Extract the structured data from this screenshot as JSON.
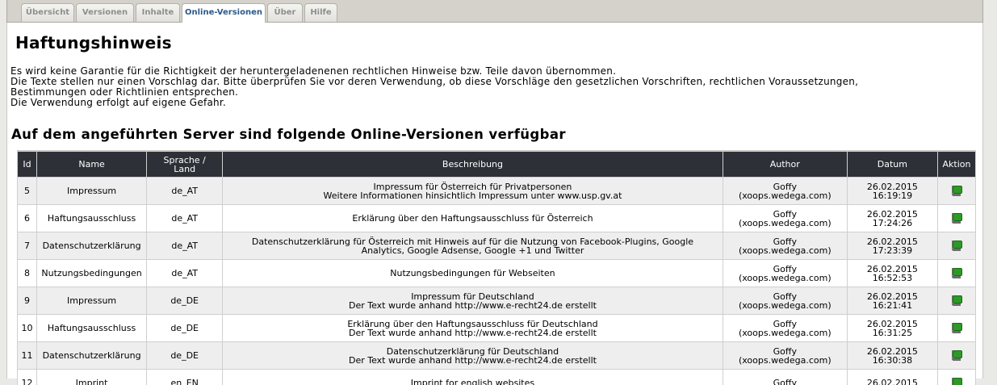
{
  "tabs": [
    {
      "label": "Übersicht",
      "active": false
    },
    {
      "label": "Versionen",
      "active": false
    },
    {
      "label": "Inhalte",
      "active": false
    },
    {
      "label": "Online-Versionen",
      "active": true
    },
    {
      "label": "Über",
      "active": false
    },
    {
      "label": "Hilfe",
      "active": false
    }
  ],
  "page": {
    "title": "Haftungshinweis",
    "disclaimer_lines": [
      "Es wird keine Garantie für die Richtigkeit der heruntergeladenenen rechtlichen Hinweise bzw. Teile davon übernommen.",
      "Die Texte stellen nur einen Vorschlag dar. Bitte überprüfen Sie vor deren Verwendung, ob diese Vorschläge den gesetzlichen Vorschriften, rechtlichen Voraussetzungen,",
      "Bestimmungen oder Richtlinien entsprechen.",
      "Die Verwendung erfolgt auf eigene Gefahr."
    ],
    "section_title": "Auf dem angeführten Server sind folgende Online-Versionen verfügbar"
  },
  "table": {
    "headers": {
      "id": "Id",
      "name": "Name",
      "lang_1": "Sprache /",
      "lang_2": "Land",
      "description": "Beschreibung",
      "author": "Author",
      "date": "Datum",
      "action": "Aktion"
    },
    "action_icon": "download-icon",
    "rows": [
      {
        "id": "5",
        "name": "Impressum",
        "lang": "de_AT",
        "desc_1": "Impressum für Österreich für Privatpersonen",
        "desc_2": "Weitere Informationen hinsichtlich Impressum unter www.usp.gv.at",
        "author_1": "Goffy",
        "author_2": "(xoops.wedega.com)",
        "date": "26.02.2015",
        "time": "16:19:19"
      },
      {
        "id": "6",
        "name": "Haftungsausschluss",
        "lang": "de_AT",
        "desc_1": "Erklärung über den Haftungsausschluss für Österreich",
        "desc_2": "",
        "author_1": "Goffy",
        "author_2": "(xoops.wedega.com)",
        "date": "26.02.2015",
        "time": "17:24:26"
      },
      {
        "id": "7",
        "name": "Datenschutzerklärung",
        "lang": "de_AT",
        "desc_1": "Datenschutzerklärung für Österreich mit Hinweis auf für die Nutzung von Facebook-Plugins, Google",
        "desc_2": "Analytics, Google Adsense, Google +1 und Twitter",
        "author_1": "Goffy",
        "author_2": "(xoops.wedega.com)",
        "date": "26.02.2015",
        "time": "17:23:39"
      },
      {
        "id": "8",
        "name": "Nutzungsbedingungen",
        "lang": "de_AT",
        "desc_1": "Nutzungsbedingungen für Webseiten",
        "desc_2": "",
        "author_1": "Goffy",
        "author_2": "(xoops.wedega.com)",
        "date": "26.02.2015",
        "time": "16:52:53"
      },
      {
        "id": "9",
        "name": "Impressum",
        "lang": "de_DE",
        "desc_1": "Impressum für Deutschland",
        "desc_2": "Der Text wurde anhand http://www.e-recht24.de erstellt",
        "author_1": "Goffy",
        "author_2": "(xoops.wedega.com)",
        "date": "26.02.2015",
        "time": "16:21:41"
      },
      {
        "id": "10",
        "name": "Haftungsausschluss",
        "lang": "de_DE",
        "desc_1": "Erklärung über den Haftungsausschluss für Deutschland",
        "desc_2": "Der Text wurde anhand http://www.e-recht24.de erstellt",
        "author_1": "Goffy",
        "author_2": "(xoops.wedega.com)",
        "date": "26.02.2015",
        "time": "16:31:25"
      },
      {
        "id": "11",
        "name": "Datenschutzerklärung",
        "lang": "de_DE",
        "desc_1": "Datenschutzerklärung für Deutschland",
        "desc_2": "Der Text wurde anhand http://www.e-recht24.de erstellt",
        "author_1": "Goffy",
        "author_2": "(xoops.wedega.com)",
        "date": "26.02.2015",
        "time": "16:30:38"
      },
      {
        "id": "12",
        "name": "Imprint",
        "lang": "en_EN",
        "desc_1": "Imprint for english websites",
        "desc_2": "",
        "author_1": "Goffy",
        "author_2": "",
        "date": "26.02.2015",
        "time": ""
      }
    ]
  }
}
